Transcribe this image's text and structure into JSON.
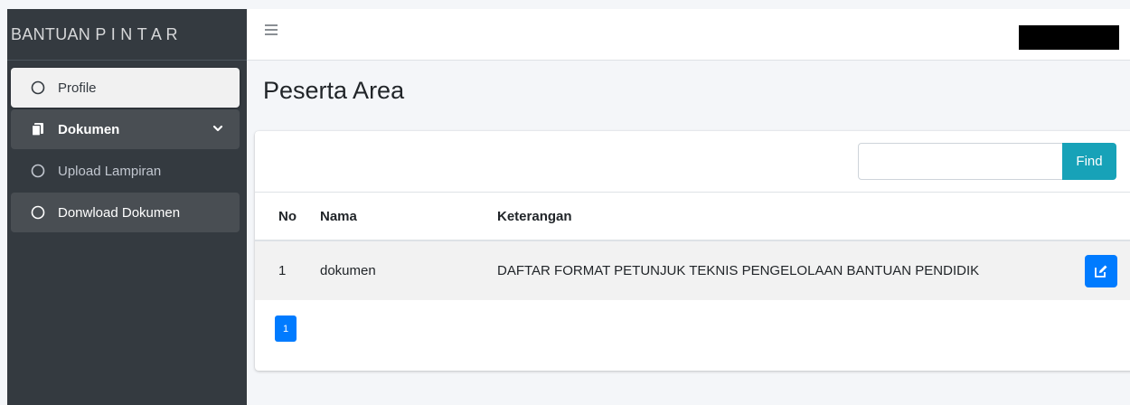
{
  "sidebar": {
    "brand": "BANTUAN P I N T A R",
    "items": [
      {
        "label": "Profile",
        "icon": "circle-outline-icon"
      },
      {
        "label": "Dokumen",
        "icon": "copy-files-icon"
      },
      {
        "label": "Upload Lampiran",
        "icon": "circle-outline-icon"
      },
      {
        "label": "Donwload Dokumen",
        "icon": "circle-outline-icon"
      }
    ]
  },
  "page": {
    "title": "Peserta Area"
  },
  "search": {
    "value": "",
    "find_label": "Find"
  },
  "table": {
    "headers": [
      "No",
      "Nama",
      "Keterangan"
    ],
    "rows": [
      {
        "no": "1",
        "nama": "dokumen",
        "keterangan": "DAFTAR FORMAT PETUNJUK TEKNIS PENGELOLAAN BANTUAN PENDIDIK"
      }
    ]
  },
  "pagination": {
    "current": "1"
  },
  "colors": {
    "sidebar_bg": "#343a40",
    "primary": "#007bff",
    "info": "#17a2b8"
  }
}
